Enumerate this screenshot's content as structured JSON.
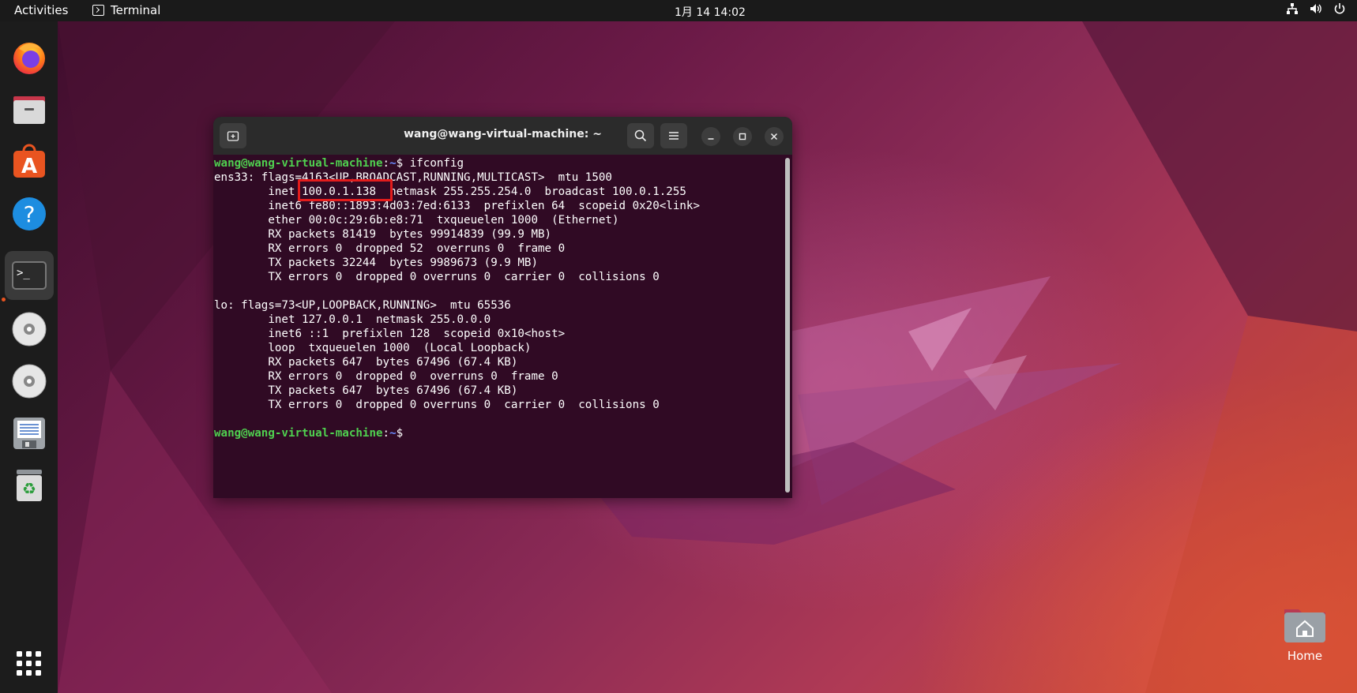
{
  "topbar": {
    "activities": "Activities",
    "app_name": "Terminal",
    "clock": "1月 14  14:02",
    "tray_icons": [
      "network-icon",
      "volume-icon",
      "power-icon"
    ]
  },
  "dock": {
    "items": [
      {
        "name": "firefox",
        "icon": "firefox-icon"
      },
      {
        "name": "files",
        "icon": "files-icon"
      },
      {
        "name": "app-center",
        "icon": "software-icon"
      },
      {
        "name": "help",
        "icon": "help-icon"
      },
      {
        "name": "terminal",
        "icon": "terminal-icon",
        "active": true
      },
      {
        "name": "disc-1",
        "icon": "disc-icon"
      },
      {
        "name": "disc-2",
        "icon": "disc-icon"
      },
      {
        "name": "text-editor",
        "icon": "editor-icon"
      },
      {
        "name": "trash",
        "icon": "trash-icon"
      }
    ],
    "show_apps_icon": "grid-icon"
  },
  "terminal": {
    "title": "wang@wang-virtual-machine: ~",
    "prompt_user": "wang@wang-virtual-machine",
    "prompt_path": "~",
    "prompt_symbol": "$",
    "command": " ifconfig",
    "output": [
      "ens33: flags=4163<UP,BROADCAST,RUNNING,MULTICAST>  mtu 1500",
      "        inet 100.0.1.138  netmask 255.255.254.0  broadcast 100.0.1.255",
      "        inet6 fe80::1893:4d03:7ed:6133  prefixlen 64  scopeid 0x20<link>",
      "        ether 00:0c:29:6b:e8:71  txqueuelen 1000  (Ethernet)",
      "        RX packets 81419  bytes 99914839 (99.9 MB)",
      "        RX errors 0  dropped 52  overruns 0  frame 0",
      "        TX packets 32244  bytes 9989673 (9.9 MB)",
      "        TX errors 0  dropped 0 overruns 0  carrier 0  collisions 0",
      "",
      "lo: flags=73<UP,LOOPBACK,RUNNING>  mtu 65536",
      "        inet 127.0.0.1  netmask 255.0.0.0",
      "        inet6 ::1  prefixlen 128  scopeid 0x10<host>",
      "        loop  txqueuelen 1000  (Local Loopback)",
      "        RX packets 647  bytes 67496 (67.4 KB)",
      "        RX errors 0  dropped 0  overruns 0  frame 0",
      "        TX packets 647  bytes 67496 (67.4 KB)",
      "        TX errors 0  dropped 0 overruns 0  carrier 0  collisions 0",
      ""
    ],
    "colors": {
      "background": "#300a24",
      "prompt_user": "#4fd04f",
      "prompt_path": "#6b8bff",
      "highlight": "#e31c1c"
    }
  },
  "desktop": {
    "home_label": "Home"
  }
}
